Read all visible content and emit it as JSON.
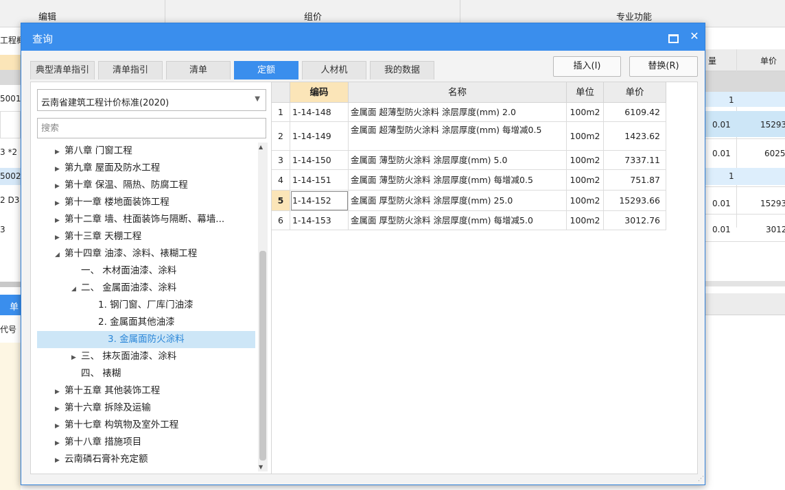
{
  "background": {
    "ribbon_groups": [
      "编辑",
      "组价",
      "专业功能"
    ],
    "left_labels": [
      "工程概",
      "5001",
      "3 *2",
      "5002",
      "2 D3",
      "3",
      "单",
      "代号"
    ],
    "right_headers": [
      "量",
      "单价"
    ],
    "rows": [
      {
        "qty": "1",
        "price": ""
      },
      {
        "qty": "0.01",
        "price": "15293"
      },
      {
        "qty": "0.01",
        "price": "6025"
      },
      {
        "qty": "1",
        "price": ""
      },
      {
        "qty": "0.01",
        "price": "15293"
      },
      {
        "qty": "0.01",
        "price": "3012"
      }
    ]
  },
  "dialog": {
    "title": "查询",
    "tabs": [
      {
        "label": "典型清单指引",
        "active": false
      },
      {
        "label": "清单指引",
        "active": false
      },
      {
        "label": "清单",
        "active": false
      },
      {
        "label": "定额",
        "active": true
      },
      {
        "label": "人材机",
        "active": false
      },
      {
        "label": "我的数据",
        "active": false
      }
    ],
    "buttons": {
      "insert": "插入(I)",
      "replace": "替换(R)"
    },
    "standard_select": "云南省建筑工程计价标准(2020)",
    "search_placeholder": "搜索",
    "tree": [
      {
        "label": "第八章 门窗工程",
        "level": 0,
        "expander": "collapsed"
      },
      {
        "label": "第九章 屋面及防水工程",
        "level": 0,
        "expander": "collapsed"
      },
      {
        "label": "第十章 保温、隔热、防腐工程",
        "level": 0,
        "expander": "collapsed"
      },
      {
        "label": "第十一章 楼地面装饰工程",
        "level": 0,
        "expander": "collapsed"
      },
      {
        "label": "第十二章 墙、柱面装饰与隔断、幕墙...",
        "level": 0,
        "expander": "collapsed"
      },
      {
        "label": "第十三章 天棚工程",
        "level": 0,
        "expander": "collapsed"
      },
      {
        "label": "第十四章 油漆、涂料、裱糊工程",
        "level": 0,
        "expander": "expanded"
      },
      {
        "label": "一、 木材面油漆、涂料",
        "level": 1,
        "expander": "none"
      },
      {
        "label": "二、 金属面油漆、涂料",
        "level": 1,
        "expander": "expanded"
      },
      {
        "label": "1. 钢门窗、厂库门油漆",
        "level": 2,
        "expander": "none"
      },
      {
        "label": "2. 金属面其他油漆",
        "level": 2,
        "expander": "none"
      },
      {
        "label": "3. 金属面防火涂料",
        "level": 2,
        "expander": "none",
        "selected": true
      },
      {
        "label": "三、 抹灰面油漆、涂料",
        "level": 1,
        "expander": "collapsed"
      },
      {
        "label": "四、 裱糊",
        "level": 1,
        "expander": "none"
      },
      {
        "label": "第十五章 其他装饰工程",
        "level": 0,
        "expander": "collapsed"
      },
      {
        "label": "第十六章 拆除及运输",
        "level": 0,
        "expander": "collapsed"
      },
      {
        "label": "第十七章 构筑物及室外工程",
        "level": 0,
        "expander": "collapsed"
      },
      {
        "label": "第十八章 措施项目",
        "level": 0,
        "expander": "collapsed"
      },
      {
        "label": "云南磷石膏补充定额",
        "level": 0,
        "expander": "collapsed"
      }
    ],
    "table": {
      "headers": {
        "code": "编码",
        "name": "名称",
        "unit": "单位",
        "price": "单价"
      },
      "rows": [
        {
          "num": "1",
          "code": "1-14-148",
          "name": "金属面 超薄型防火涂料 涂层厚度(mm) 2.0",
          "unit": "100m2",
          "price": "6109.42"
        },
        {
          "num": "2",
          "code": "1-14-149",
          "name": "金属面 超薄型防火涂料 涂层厚度(mm) 每增减0.5",
          "unit": "100m2",
          "price": "1423.62"
        },
        {
          "num": "3",
          "code": "1-14-150",
          "name": "金属面 薄型防火涂料 涂层厚度(mm) 5.0",
          "unit": "100m2",
          "price": "7337.11"
        },
        {
          "num": "4",
          "code": "1-14-151",
          "name": "金属面 薄型防火涂料 涂层厚度(mm) 每增减0.5",
          "unit": "100m2",
          "price": "751.87"
        },
        {
          "num": "5",
          "code": "1-14-152",
          "name": "金属面 厚型防火涂料 涂层厚度(mm) 25.0",
          "unit": "100m2",
          "price": "15293.66",
          "selected": true
        },
        {
          "num": "6",
          "code": "1-14-153",
          "name": "金属面 厚型防火涂料 涂层厚度(mm) 每增减5.0",
          "unit": "100m2",
          "price": "3012.76"
        }
      ]
    }
  },
  "colors": {
    "accent": "#3a8eed",
    "highlight": "#fbe5b8",
    "tree_selection": "#cde6f7"
  }
}
